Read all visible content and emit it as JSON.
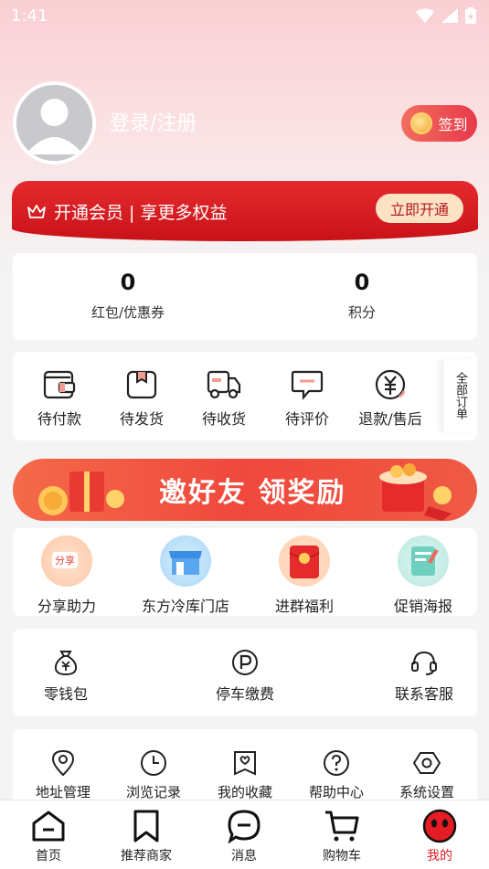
{
  "status_bar": {
    "time": "1:41"
  },
  "profile": {
    "login_label": "登录/注册",
    "signin_label": "签到"
  },
  "vip": {
    "text": "开通会员 | 享更多权益",
    "button": "立即开通"
  },
  "stats": [
    {
      "value": "0",
      "label": "红包/优惠券"
    },
    {
      "value": "0",
      "label": "积分"
    }
  ],
  "orders": {
    "items": [
      {
        "label": "待付款",
        "icon": "wallet-icon"
      },
      {
        "label": "待发货",
        "icon": "package-icon"
      },
      {
        "label": "待收货",
        "icon": "truck-icon"
      },
      {
        "label": "待评价",
        "icon": "comment-icon"
      },
      {
        "label": "退款/售后",
        "icon": "refund-icon"
      }
    ],
    "all_label": "全部订单"
  },
  "banner": {
    "text": "邀好友 领奖励"
  },
  "features": [
    {
      "label": "分享助力",
      "badge": "分享"
    },
    {
      "label": "东方冷库门店"
    },
    {
      "label": "进群福利"
    },
    {
      "label": "促销海报"
    }
  ],
  "services": [
    {
      "label": "零钱包",
      "icon": "money-bag-icon"
    },
    {
      "label": "停车缴费",
      "icon": "parking-icon"
    },
    {
      "label": "联系客服",
      "icon": "headset-icon"
    }
  ],
  "tools": [
    {
      "label": "地址管理",
      "icon": "location-icon"
    },
    {
      "label": "浏览记录",
      "icon": "clock-icon"
    },
    {
      "label": "我的收藏",
      "icon": "favorite-icon"
    },
    {
      "label": "帮助中心",
      "icon": "help-icon"
    },
    {
      "label": "系统设置",
      "icon": "settings-icon"
    }
  ],
  "tabbar": [
    {
      "label": "首页",
      "icon": "home-icon"
    },
    {
      "label": "推荐商家",
      "icon": "bookmark-icon"
    },
    {
      "label": "消息",
      "icon": "message-icon"
    },
    {
      "label": "购物车",
      "icon": "cart-icon"
    },
    {
      "label": "我的",
      "icon": "profile-icon",
      "active": true
    }
  ],
  "colors": {
    "accent": "#e51c23",
    "vip_bg": "#d81c22",
    "vip_button": "#fde2c4"
  }
}
